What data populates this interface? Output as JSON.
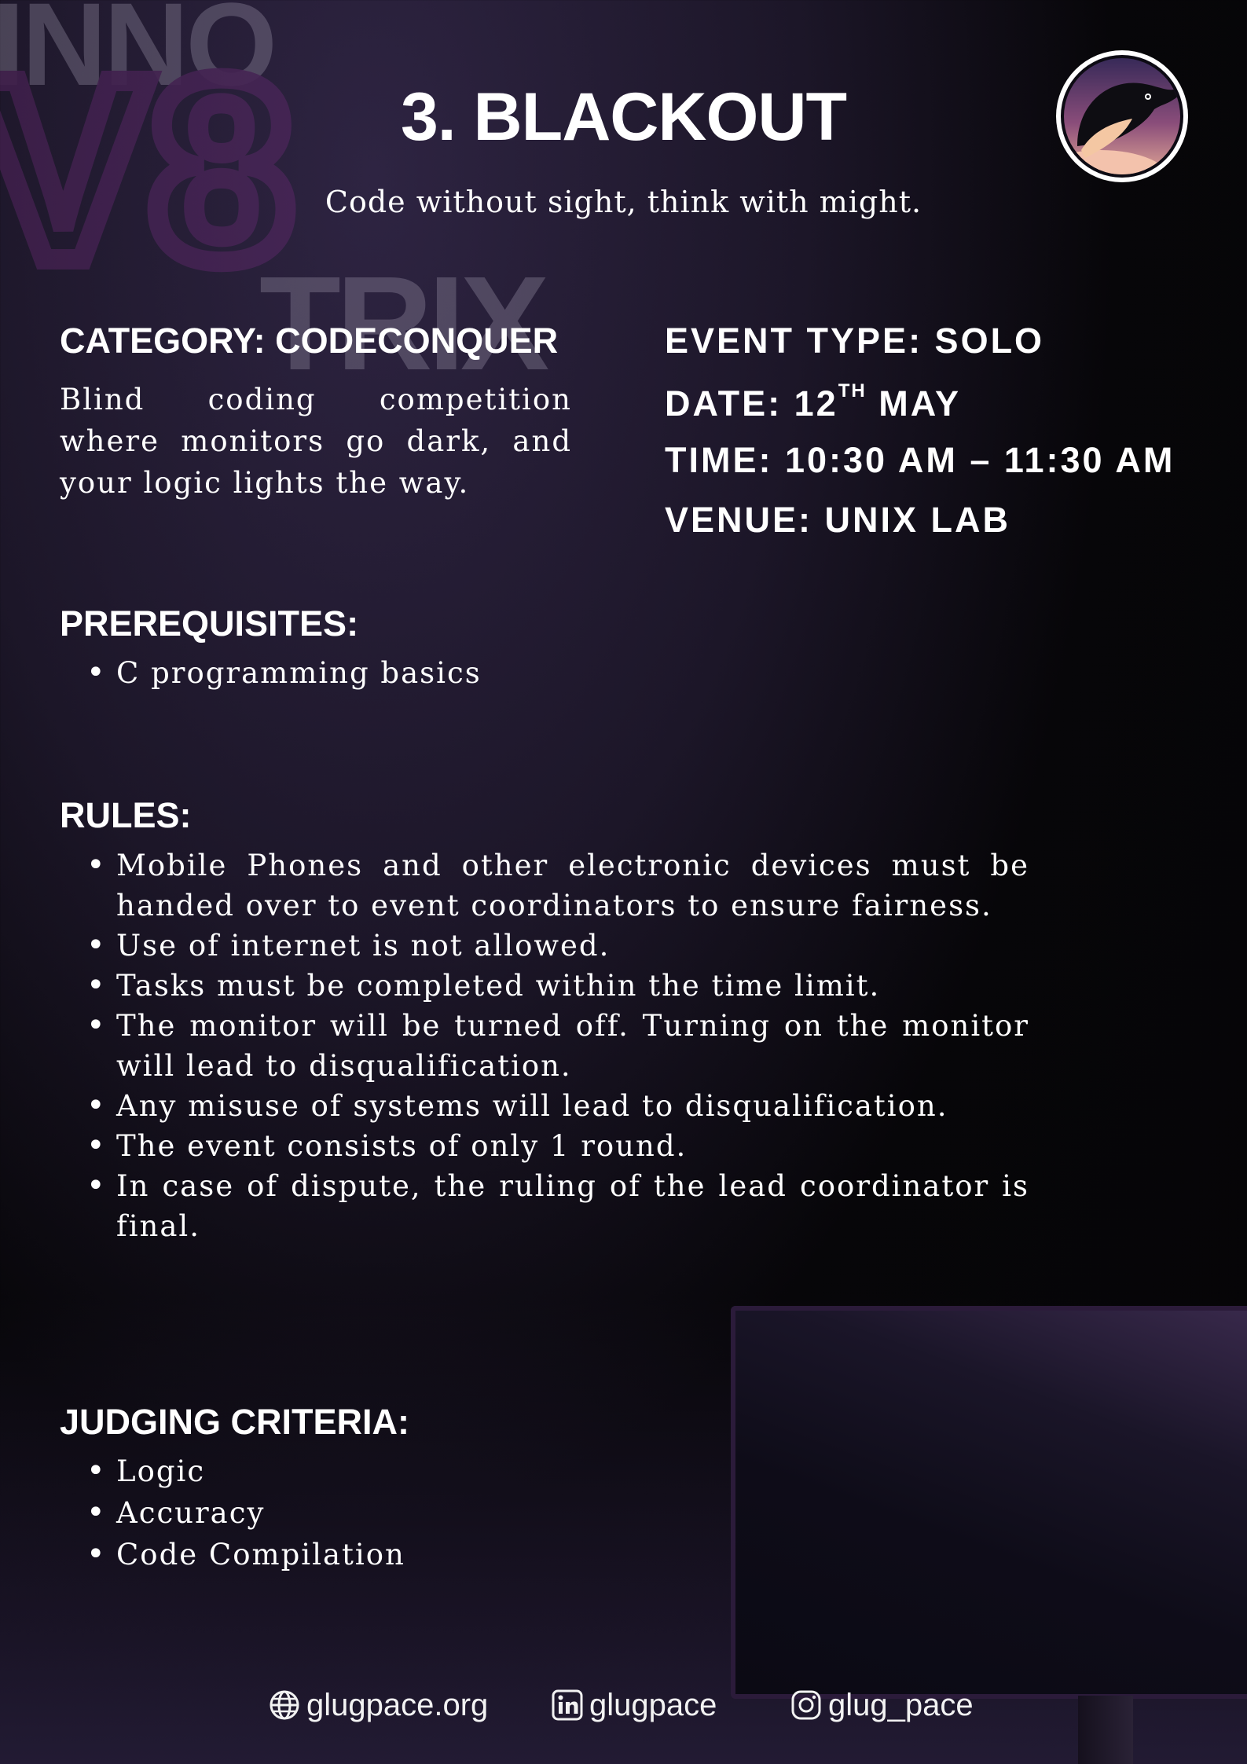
{
  "header": {
    "title": "3. BLACKOUT",
    "tagline": "Code without sight, think with might."
  },
  "category": {
    "heading": "CATEGORY: CODECONQUER",
    "description": "Blind coding competition where monitors go dark, and your logic lights the way."
  },
  "event_info": {
    "type": "EVENT TYPE: SOLO",
    "date_prefix": "DATE: 12",
    "date_sup": "TH",
    "date_suffix": " MAY",
    "time": "TIME: 10:30 AM – 11:30 AM",
    "venue": "VENUE:  UNIX LAB"
  },
  "prerequisites": {
    "heading": "PREREQUISITES:",
    "items": [
      "C programming basics"
    ]
  },
  "rules": {
    "heading": "RULES:",
    "items": [
      "Mobile Phones and other electronic devices must be handed over to event coordinators to ensure fairness.",
      "Use of internet is not allowed.",
      "Tasks must be completed within the time limit.",
      "The monitor will be turned off. Turning on the monitor will lead to disqualification.",
      "Any misuse of systems will lead to disqualification.",
      "The event consists of only 1 round.",
      "In case of dispute, the ruling of the lead coordinator is final."
    ]
  },
  "judging": {
    "heading": "JUDGING CRITERIA:",
    "items": [
      "Logic",
      "Accuracy",
      "Code Compilation"
    ]
  },
  "footer": {
    "website": "glugpace.org",
    "linkedin": "glugpace",
    "instagram": "glug_pace"
  },
  "watermark": {
    "letters_top": "INNO",
    "letters_mid": "V8",
    "letters_bottom": "TRIX"
  },
  "colors": {
    "accent_purple": "#7b2e84",
    "watermark_gray": "#9a93a8",
    "badge_peach": "#e8a98f",
    "badge_violet": "#5b3d6e"
  },
  "icons": {
    "website": "globe-icon",
    "linkedin": "linkedin-icon",
    "instagram": "instagram-icon",
    "badge": "penguin-logo"
  }
}
